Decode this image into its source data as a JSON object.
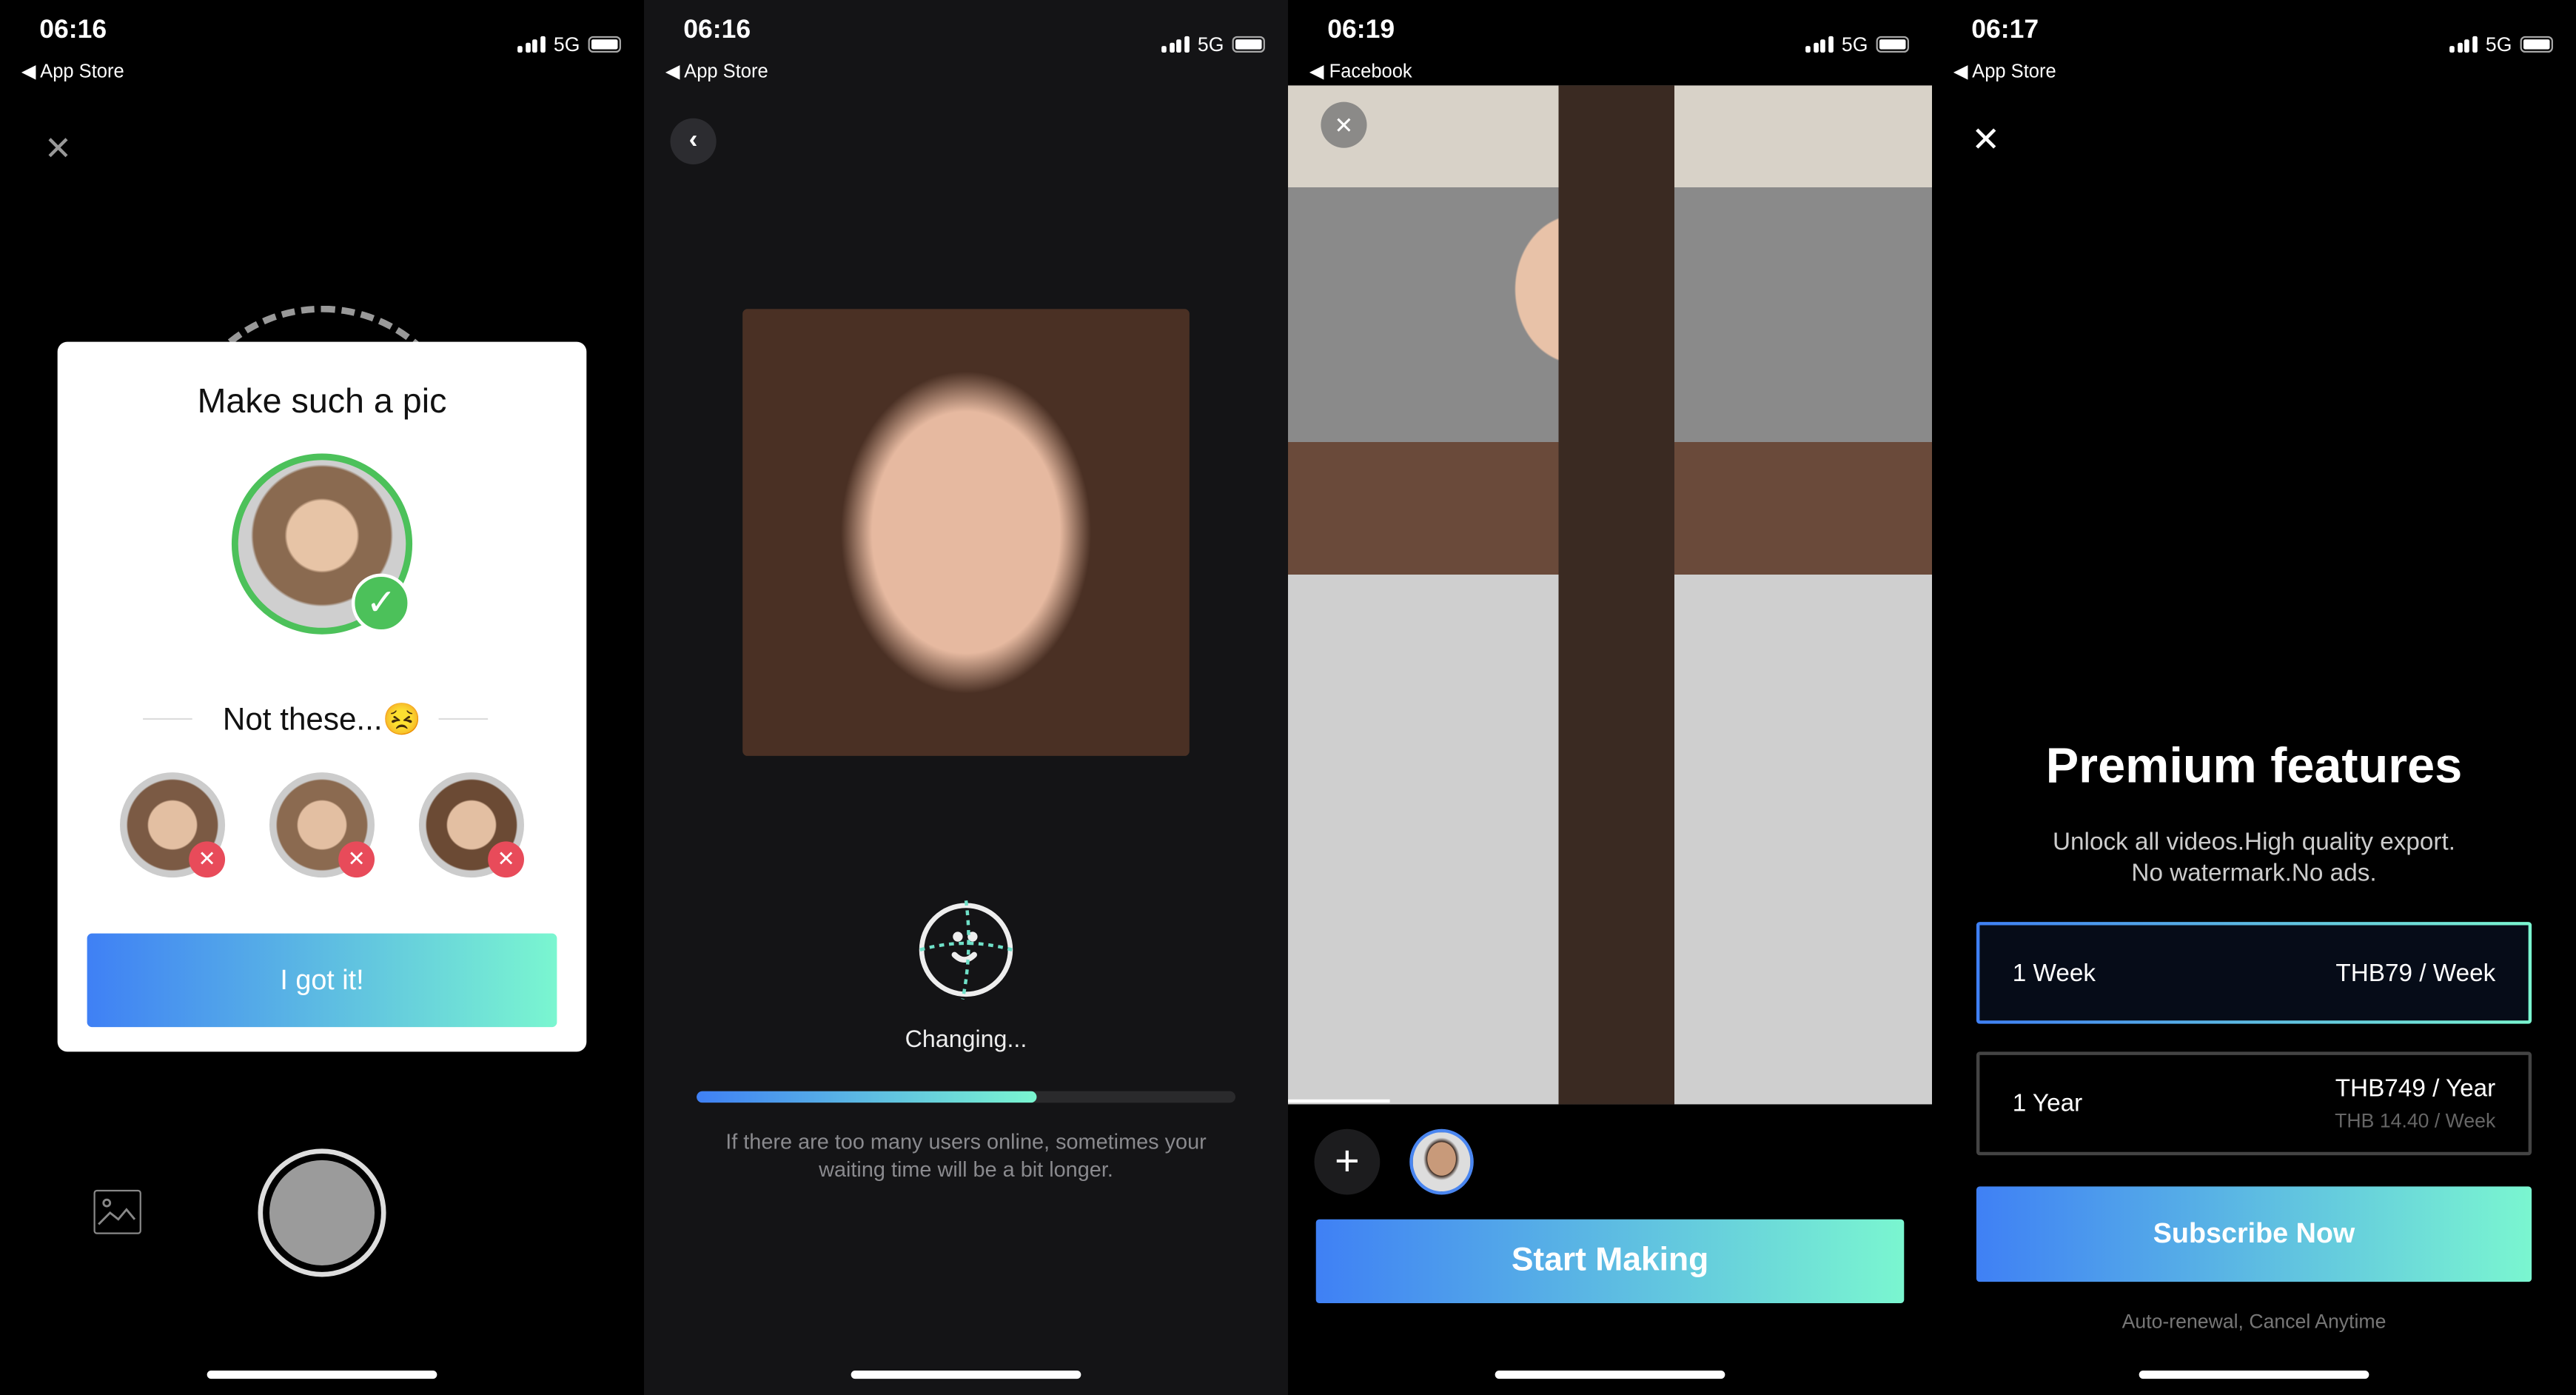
{
  "colors": {
    "accent_start": "#3f80f5",
    "accent_end": "#7af6d0",
    "success": "#4cc15a",
    "error": "#e84b5a"
  },
  "panels": [
    {
      "status": {
        "time": "06:16",
        "back_label": "App Store",
        "network": "5G"
      },
      "close_icon": "close-icon",
      "card": {
        "title": "Make such a pic",
        "subtitle": "Not these...😣",
        "button": "I got it!"
      },
      "gallery_icon": "image-icon",
      "shutter_icon": "shutter-button"
    },
    {
      "status": {
        "time": "06:16",
        "back_label": "App Store",
        "network": "5G"
      },
      "status_text": "Changing...",
      "progress_percent": 63,
      "hint": "If there are too many users online, sometimes your waiting time will be a bit longer."
    },
    {
      "status": {
        "time": "06:19",
        "back_label": "Facebook",
        "network": "5G"
      },
      "button": "Start Making"
    },
    {
      "status": {
        "time": "06:17",
        "back_label": "App Store",
        "network": "5G"
      },
      "title": "Premium features",
      "subtitle_line1": "Unlock all videos.High quality export.",
      "subtitle_line2": "No watermark.No ads.",
      "plans": [
        {
          "name": "1 Week",
          "price": "THB79 / Week",
          "selected": true
        },
        {
          "name": "1 Year",
          "price": "THB749 / Year",
          "sub_price": "THB 14.40 / Week",
          "selected": false
        }
      ],
      "subscribe": "Subscribe Now",
      "footnote": "Auto-renewal, Cancel Anytime"
    }
  ]
}
